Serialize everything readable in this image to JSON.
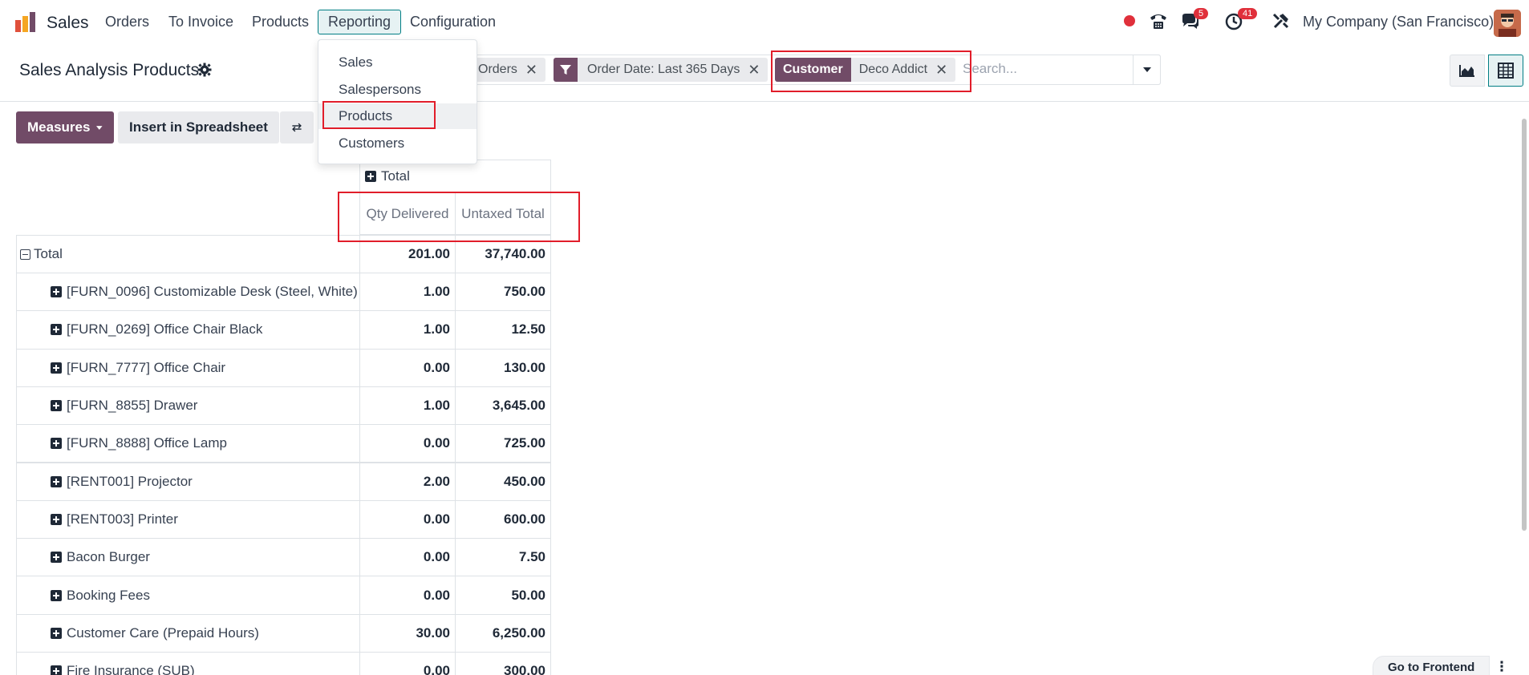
{
  "navbar": {
    "app_name": "Sales",
    "menu": [
      "Orders",
      "To Invoice",
      "Products",
      "Reporting",
      "Configuration"
    ],
    "active_menu": "Reporting",
    "chat_badge": "5",
    "activity_badge": "41",
    "company": "My Company (San Francisco)"
  },
  "reporting_dropdown": {
    "items": [
      "Sales",
      "Salespersons",
      "Products",
      "Customers"
    ],
    "highlighted": "Products"
  },
  "control_panel": {
    "title": "Sales Analysis Products",
    "facets": {
      "orders_value": "Orders",
      "date_value": "Order Date: Last 365 Days",
      "customer_tag": "Customer",
      "customer_value": "Deco Addict"
    },
    "search_placeholder": "Search...",
    "measures_label": "Measures",
    "insert_label": "Insert in Spreadsheet"
  },
  "pivot": {
    "col_header": "Total",
    "measures": [
      "Qty Delivered",
      "Untaxed Total"
    ],
    "total_row": {
      "label": "Total",
      "qty": "201.00",
      "untaxed": "37,740.00"
    },
    "rows": [
      {
        "label": "[FURN_0096] Customizable Desk (Steel, White)",
        "qty": "1.00",
        "untaxed": "750.00"
      },
      {
        "label": "[FURN_0269] Office Chair Black",
        "qty": "1.00",
        "untaxed": "12.50"
      },
      {
        "label": "[FURN_7777] Office Chair",
        "qty": "0.00",
        "untaxed": "130.00"
      },
      {
        "label": "[FURN_8855] Drawer",
        "qty": "1.00",
        "untaxed": "3,645.00"
      },
      {
        "label": "[FURN_8888] Office Lamp",
        "qty": "0.00",
        "untaxed": "725.00"
      },
      {
        "label": "[RENT001] Projector",
        "qty": "2.00",
        "untaxed": "450.00"
      },
      {
        "label": "[RENT003] Printer",
        "qty": "0.00",
        "untaxed": "600.00"
      },
      {
        "label": "Bacon Burger",
        "qty": "0.00",
        "untaxed": "7.50"
      },
      {
        "label": "Booking Fees",
        "qty": "0.00",
        "untaxed": "50.00"
      },
      {
        "label": "Customer Care (Prepaid Hours)",
        "qty": "30.00",
        "untaxed": "6,250.00"
      },
      {
        "label": "Fire Insurance (SUB)",
        "qty": "0.00",
        "untaxed": "300.00"
      }
    ]
  },
  "footer": {
    "frontend_label": "Go to Frontend"
  },
  "colors": {
    "brand": "#714b67",
    "accent": "#017e84",
    "highlight": "#e11d2a"
  }
}
